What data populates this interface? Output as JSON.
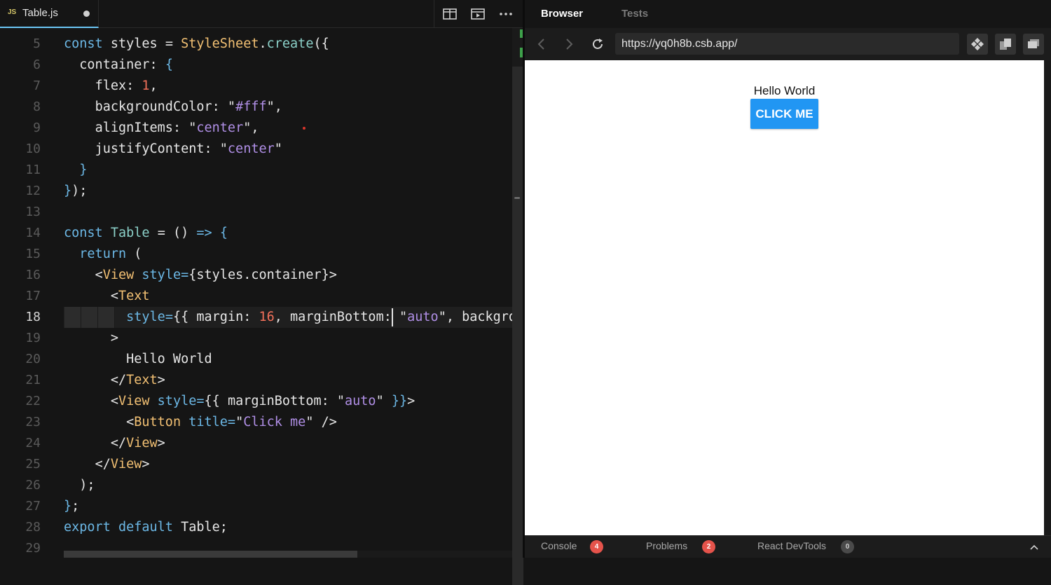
{
  "editor": {
    "tab": {
      "lang_badge": "JS",
      "filename": "Table.js"
    },
    "line_numbers": [
      "5",
      "6",
      "7",
      "8",
      "9",
      "10",
      "11",
      "12",
      "13",
      "14",
      "15",
      "16",
      "17",
      "18",
      "19",
      "20",
      "21",
      "22",
      "23",
      "24",
      "25",
      "26",
      "27",
      "28",
      "29"
    ],
    "active_line": "18"
  },
  "browser": {
    "tabs": {
      "browser": "Browser",
      "tests": "Tests"
    },
    "url": "https://yq0h8b.csb.app/",
    "preview": {
      "text": "Hello World",
      "button": "CLICK ME"
    },
    "bottom_tabs": [
      {
        "label": "Console",
        "count": "4"
      },
      {
        "label": "Problems",
        "count": "2"
      },
      {
        "label": "React DevTools",
        "count": "0"
      }
    ]
  },
  "colors": {
    "accent_blue": "#2196f3",
    "badge_red": "#e5534b",
    "editor_bg": "#151515"
  }
}
